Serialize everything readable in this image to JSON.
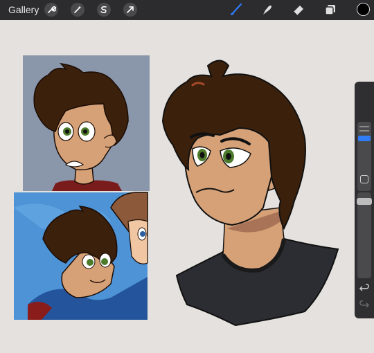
{
  "app": {
    "gallery_label": "Gallery"
  },
  "toolbar": {
    "left_tools": [
      "wrench-icon",
      "magic-wand-icon",
      "selection-icon",
      "transform-icon"
    ],
    "right_tools": [
      "brush-icon",
      "smudge-icon",
      "eraser-icon",
      "layers-icon"
    ],
    "active_tool": "brush-icon",
    "current_color": "#000000",
    "accent_color": "#2f7cf6"
  },
  "sidebar": {
    "brush_size_level": 0.3,
    "opacity_level": 0.0
  },
  "colors": {
    "canvas_bg": "#e4e1de",
    "hair": "#3b200c",
    "skin": "#d6a177",
    "shirt": "#2b2d33",
    "eyes": "#4e7a2c"
  }
}
